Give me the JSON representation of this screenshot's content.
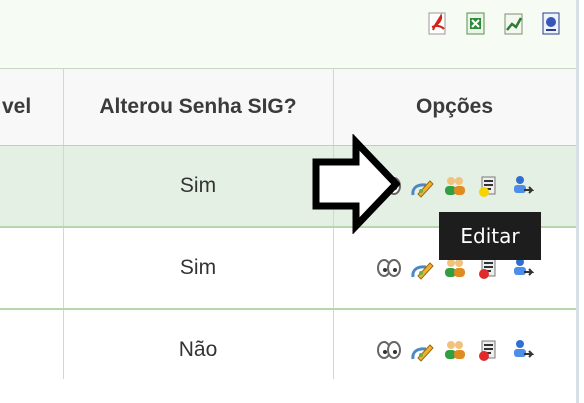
{
  "table": {
    "headers": {
      "partial_left": "vel",
      "alterou_senha": "Alterou Senha SIG?",
      "opcoes": "Opções"
    },
    "rows": [
      {
        "alterou_senha": "Sim",
        "selected": true
      },
      {
        "alterou_senha": "Sim",
        "selected": false
      },
      {
        "alterou_senha": "Não",
        "selected": false
      }
    ]
  },
  "tooltip": {
    "text": "Editar"
  },
  "export_icons": [
    "pdf-icon",
    "excel-icon",
    "chart-icon",
    "document-icon"
  ],
  "row_option_icons": [
    "view-icon",
    "edit-icon",
    "users-icon",
    "report-icon",
    "transfer-icon"
  ],
  "colors": {
    "selected_row": "#e5f0e4",
    "row_border": "#b6d7ab",
    "tooltip_bg": "#1d1d1d",
    "topbar_bg": "#f6fbf3"
  }
}
